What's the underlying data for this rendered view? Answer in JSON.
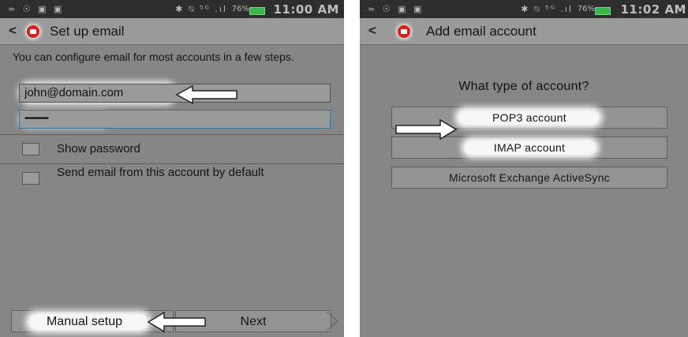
{
  "left_screen": {
    "status": {
      "icons_left": "≈ ☉ ▣ ▣",
      "icons_right": "✱ ⍉ ⁵ᴳ .ıl",
      "battery_pct": "76%",
      "time": "11:00 AM"
    },
    "action_bar": {
      "back_symbol": "<",
      "title": "Set up email"
    },
    "intro_text": "You can configure email for most accounts in a few steps.",
    "email_value": "john@domain.com",
    "password_value": "••••••••••••",
    "show_password_label": "Show password",
    "default_account_label": "Send email from this account by default",
    "buttons": {
      "manual_setup": "Manual setup",
      "next": "Next"
    }
  },
  "right_screen": {
    "status": {
      "icons_left": "≈ ☉ ▣ ▣",
      "icons_right": "✱ ⍉ ⁵ᴳ .ıl",
      "battery_pct": "76%",
      "time": "11:02 AM"
    },
    "action_bar": {
      "back_symbol": "<",
      "title": "Add email account"
    },
    "question": "What type of account?",
    "account_types": [
      "POP3 account",
      "IMAP account",
      "Microsoft Exchange ActiveSync"
    ]
  },
  "icons": [
    "back-icon",
    "email-app-icon",
    "pointer-arrow-icon",
    "battery-icon"
  ],
  "colors": {
    "screen_bg": "#868686",
    "status_bar": "#2e2e2e",
    "battery": "#39b54a",
    "app_icon": "#d8201c",
    "highlight_glow": "#f6f6f6"
  }
}
